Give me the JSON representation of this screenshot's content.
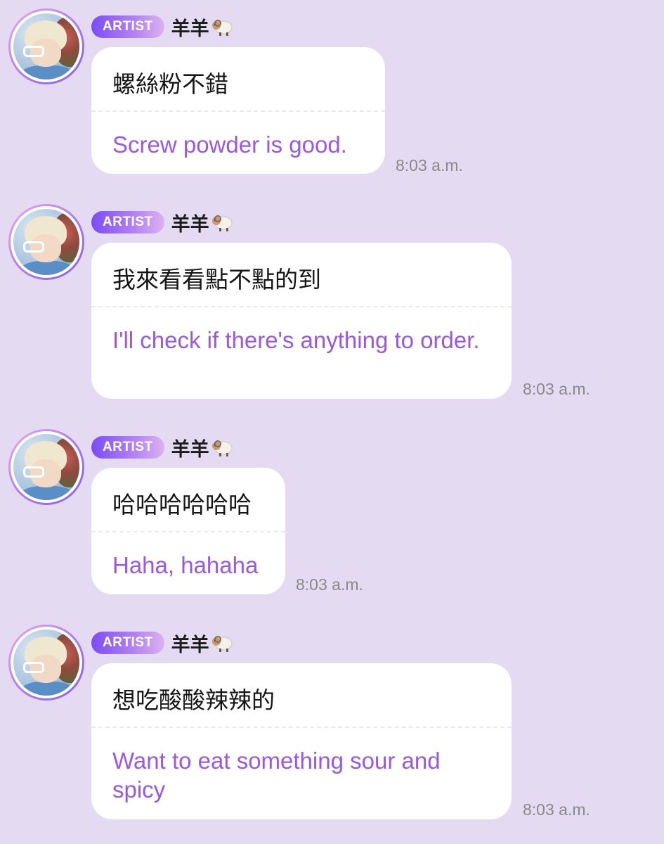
{
  "messages": [
    {
      "badge": "ARTIST",
      "username": "羊羊",
      "original": "螺絲粉不錯",
      "translation": "Screw powder is good.",
      "time": "8:03 a.m."
    },
    {
      "badge": "ARTIST",
      "username": "羊羊",
      "original": "我來看看點不點的到",
      "translation": "I'll check if there's anything to order.",
      "time": "8:03 a.m."
    },
    {
      "badge": "ARTIST",
      "username": "羊羊",
      "original": "哈哈哈哈哈哈",
      "translation": "Haha, hahaha",
      "time": "8:03 a.m."
    },
    {
      "badge": "ARTIST",
      "username": "羊羊",
      "original": "想吃酸酸辣辣的",
      "translation": "Want to eat something sour and spicy",
      "time": "8:03 a.m."
    }
  ],
  "icons": {
    "username_suffix": "sheep-icon"
  },
  "colors": {
    "background": "#e4daf2",
    "translation_text": "#9a57e6",
    "badge_start": "#7b4cf5",
    "badge_end": "#dcb2f0"
  }
}
